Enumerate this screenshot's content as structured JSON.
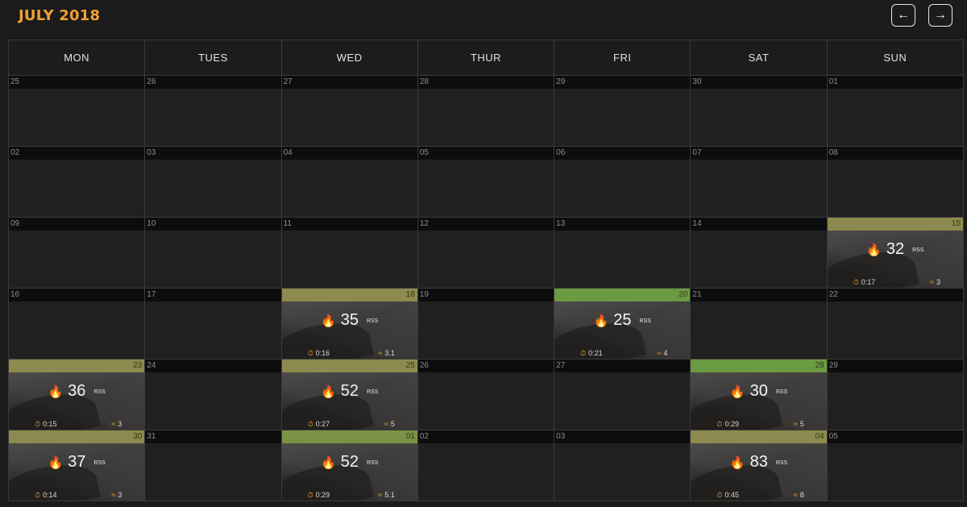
{
  "header": {
    "title": "JULY 2018",
    "prev_icon": "arrow-left-icon",
    "next_icon": "arrow-right-icon"
  },
  "weekdays": [
    "MON",
    "TUES",
    "WED",
    "THUR",
    "FRI",
    "SAT",
    "SUN"
  ],
  "colors": {
    "accent": "#f0a22f",
    "bar_a": "#8c8a4e",
    "bar_b": "#7a9246",
    "bar_c": "#6a9a42"
  },
  "weeks": [
    [
      {
        "day": "25"
      },
      {
        "day": "26"
      },
      {
        "day": "27"
      },
      {
        "day": "28"
      },
      {
        "day": "29"
      },
      {
        "day": "30"
      },
      {
        "day": "01"
      }
    ],
    [
      {
        "day": "02"
      },
      {
        "day": "03"
      },
      {
        "day": "04"
      },
      {
        "day": "05"
      },
      {
        "day": "06"
      },
      {
        "day": "07"
      },
      {
        "day": "08"
      }
    ],
    [
      {
        "day": "09"
      },
      {
        "day": "10"
      },
      {
        "day": "11"
      },
      {
        "day": "12"
      },
      {
        "day": "13"
      },
      {
        "day": "14"
      },
      {
        "day": "15",
        "activity": {
          "score": "32",
          "unit": "RSS",
          "time": "0:17",
          "count": "3",
          "bar": "c1"
        }
      }
    ],
    [
      {
        "day": "16"
      },
      {
        "day": "17"
      },
      {
        "day": "18",
        "activity": {
          "score": "35",
          "unit": "RSS",
          "time": "0:16",
          "count": "3.1",
          "bar": "c1"
        }
      },
      {
        "day": "19"
      },
      {
        "day": "20",
        "activity": {
          "score": "25",
          "unit": "RSS",
          "time": "0:21",
          "count": "4",
          "bar": "c3"
        }
      },
      {
        "day": "21"
      },
      {
        "day": "22"
      }
    ],
    [
      {
        "day": "23",
        "activity": {
          "score": "36",
          "unit": "RSS",
          "time": "0:15",
          "count": "3",
          "bar": "c1"
        }
      },
      {
        "day": "24"
      },
      {
        "day": "25",
        "activity": {
          "score": "52",
          "unit": "RSS",
          "time": "0:27",
          "count": "5",
          "bar": "c1"
        }
      },
      {
        "day": "26"
      },
      {
        "day": "27"
      },
      {
        "day": "28",
        "activity": {
          "score": "30",
          "unit": "RSS",
          "time": "0:29",
          "count": "5",
          "bar": "c3"
        }
      },
      {
        "day": "29"
      }
    ],
    [
      {
        "day": "30",
        "activity": {
          "score": "37",
          "unit": "RSS",
          "time": "0:14",
          "count": "3",
          "bar": "c1"
        }
      },
      {
        "day": "31"
      },
      {
        "day": "01",
        "activity": {
          "score": "52",
          "unit": "RSS",
          "time": "0:29",
          "count": "5.1",
          "bar": "c2"
        }
      },
      {
        "day": "02"
      },
      {
        "day": "03"
      },
      {
        "day": "04",
        "activity": {
          "score": "83",
          "unit": "RSS",
          "time": "0:45",
          "count": "8",
          "bar": "c1"
        }
      },
      {
        "day": "05"
      }
    ]
  ]
}
